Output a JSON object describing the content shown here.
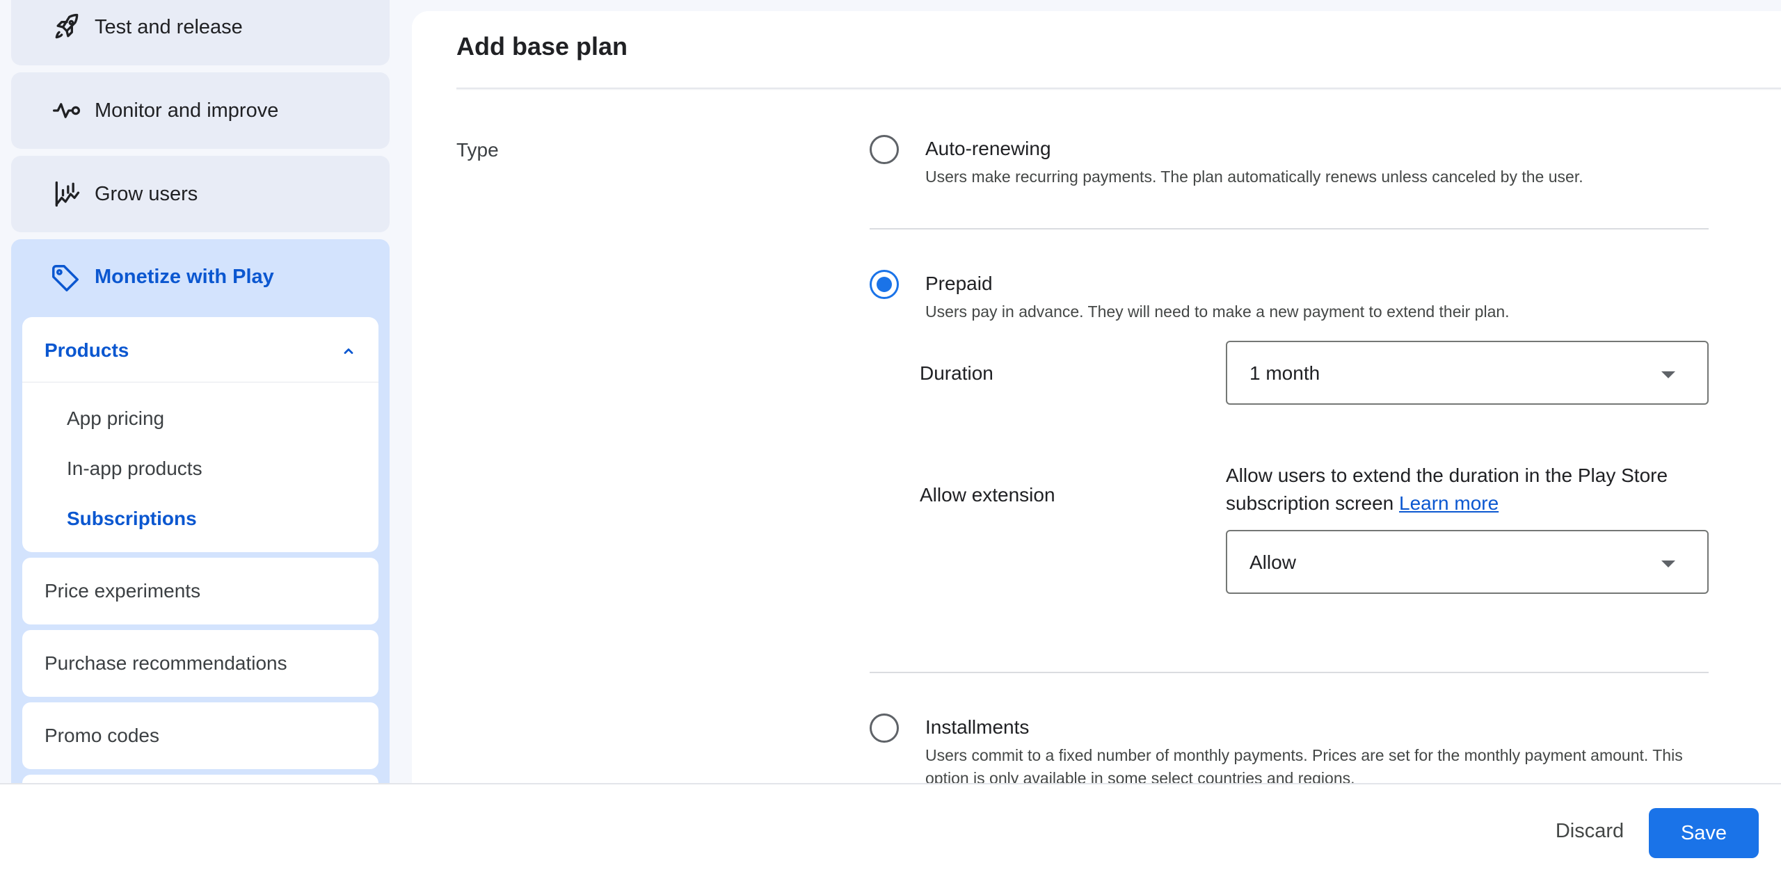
{
  "sidebar": {
    "items": [
      {
        "label": "Test and release",
        "icon": "rocket-icon"
      },
      {
        "label": "Monitor and improve",
        "icon": "vitals-icon"
      },
      {
        "label": "Grow users",
        "icon": "growth-chart-icon"
      }
    ],
    "monetize": {
      "label": "Monetize with Play",
      "icon": "tag-icon",
      "products": {
        "title": "Products",
        "expanded_icon": "chevron-up-icon",
        "items": [
          {
            "label": "App pricing",
            "active": false
          },
          {
            "label": "In-app products",
            "active": false
          },
          {
            "label": "Subscriptions",
            "active": true
          }
        ]
      },
      "more": [
        "Price experiments",
        "Purchase recommendations",
        "Promo codes"
      ]
    }
  },
  "main": {
    "title": "Add base plan",
    "type_label": "Type",
    "options": {
      "auto": {
        "title": "Auto-renewing",
        "desc": "Users make recurring payments. The plan automatically renews unless canceled by the user.",
        "selected": false
      },
      "prepaid": {
        "title": "Prepaid",
        "desc": "Users pay in advance. They will need to make a new payment to extend their plan.",
        "selected": true,
        "duration_label": "Duration",
        "duration_value": "1 month",
        "extension_label": "Allow extension",
        "extension_help": "Allow users to extend the duration in the Play Store subscription screen",
        "learn_more": "Learn more",
        "extension_value": "Allow"
      },
      "installments": {
        "title": "Installments",
        "desc": "Users commit to a fixed number of monthly payments. Prices are set for the monthly payment amount. This option is only available in some select countries and regions.",
        "selected": false
      }
    }
  },
  "footer": {
    "discard_label": "Discard",
    "save_label": "Save"
  },
  "colors": {
    "accent": "#1a73e8",
    "link": "#0b57d0",
    "active_bg": "#d3e3fd",
    "card_bg": "#e8ecf6"
  }
}
